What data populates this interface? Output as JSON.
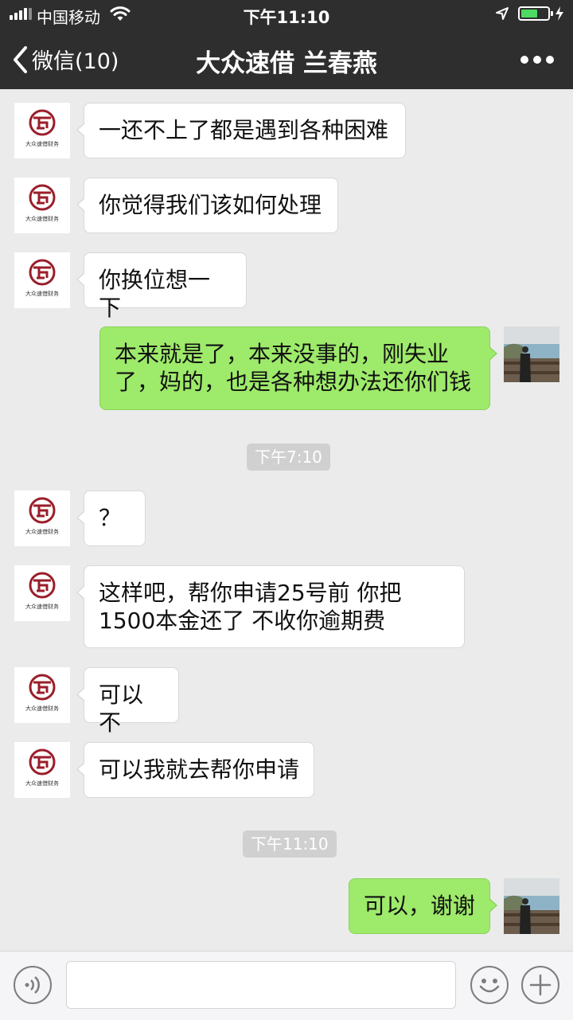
{
  "status_bar": {
    "carrier": "中国移动",
    "time": "下午11:10"
  },
  "nav": {
    "back_label": "微信(10)",
    "title": "大众速借 兰春燕"
  },
  "contact_logo_text": "大众速借财务",
  "colors": {
    "header_bg": "#2e2e2e",
    "chat_bg": "#ebebeb",
    "outgoing_bubble": "#9eea6a",
    "incoming_bubble": "#ffffff",
    "battery": "#4cd964"
  },
  "messages": [
    {
      "side": "left",
      "text": "一还不上了都是遇到各种困难"
    },
    {
      "side": "left",
      "text": "你觉得我们该如何处理"
    },
    {
      "side": "left",
      "text": "你换位想一下"
    },
    {
      "side": "right",
      "text": "本来就是了，本来没事的，刚失业了，妈的，也是各种想办法还你们钱"
    },
    {
      "side": "timestamp",
      "text": "下午7:10"
    },
    {
      "side": "left",
      "text": "？"
    },
    {
      "side": "left",
      "text": "这样吧，帮你申请25号前 你把1500本金还了 不收你逾期费"
    },
    {
      "side": "left",
      "text": "可以不"
    },
    {
      "side": "left",
      "text": "可以我就去帮你申请"
    },
    {
      "side": "timestamp",
      "text": "下午11:10"
    },
    {
      "side": "right",
      "text": "可以，谢谢"
    }
  ],
  "input_bar": {
    "voice_icon": "voice-icon",
    "emoji_icon": "emoji-icon",
    "plus_icon": "plus-icon",
    "message_value": ""
  }
}
